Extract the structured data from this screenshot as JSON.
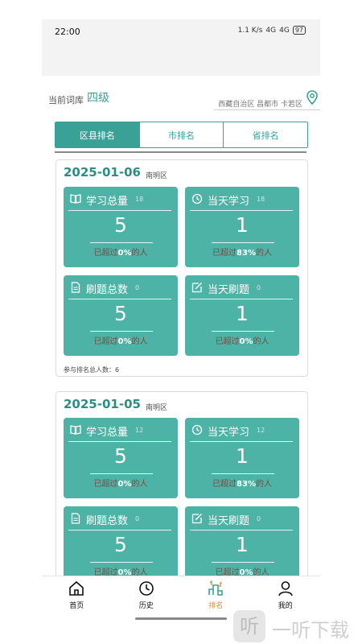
{
  "status": {
    "time": "22:00",
    "net": "1.1 K/s",
    "signal1": "4G",
    "signal2": "4G",
    "battery": "97"
  },
  "library": {
    "label": "当前词库",
    "value": "四级",
    "location": "西藏自治区 昌都市 卡若区"
  },
  "tabs": [
    "区县排名",
    "市排名",
    "省排名"
  ],
  "cards": [
    {
      "date": "2025-01-06",
      "district": "南明区",
      "tiles": [
        {
          "title": "学习总量",
          "small": "18",
          "value": "5",
          "foot_pre": "已超过",
          "pct": "0%",
          "foot_post": "的人",
          "icon": "book-icon"
        },
        {
          "title": "当天学习",
          "small": "18",
          "value": "1",
          "foot_pre": "已超过",
          "pct": "83%",
          "foot_post": "的人",
          "icon": "clock-icon"
        },
        {
          "title": "刷题总数",
          "small": "0",
          "value": "5",
          "foot_pre": "已超过",
          "pct": "0%",
          "foot_post": "的人",
          "icon": "document-icon"
        },
        {
          "title": "当天刷题",
          "small": "0",
          "value": "1",
          "foot_pre": "已超过",
          "pct": "0%",
          "foot_post": "的人",
          "icon": "edit-icon"
        }
      ],
      "total": "参与排名总人数：6"
    },
    {
      "date": "2025-01-05",
      "district": "南明区",
      "tiles": [
        {
          "title": "学习总量",
          "small": "12",
          "value": "5",
          "foot_pre": "已超过",
          "pct": "0%",
          "foot_post": "的人",
          "icon": "book-icon"
        },
        {
          "title": "当天学习",
          "small": "12",
          "value": "1",
          "foot_pre": "已超过",
          "pct": "83%",
          "foot_post": "的人",
          "icon": "clock-icon"
        },
        {
          "title": "刷题总数",
          "small": "0",
          "value": "5",
          "foot_pre": "已超过",
          "pct": "0%",
          "foot_post": "的人",
          "icon": "document-icon"
        },
        {
          "title": "当天刷题",
          "small": "0",
          "value": "1",
          "foot_pre": "已超过",
          "pct": "0%",
          "foot_post": "的人",
          "icon": "edit-icon"
        }
      ]
    }
  ],
  "nav": [
    {
      "label": "首页",
      "icon": "home-icon"
    },
    {
      "label": "历史",
      "icon": "clock-icon"
    },
    {
      "label": "排名",
      "icon": "ranking-icon",
      "active": true
    },
    {
      "label": "我的",
      "icon": "person-icon"
    }
  ],
  "watermark": {
    "logo": "听",
    "text": "一听下载"
  },
  "colors": {
    "accent": "#3aa196",
    "tile": "#4db3a6",
    "nav_active": "#e08a3a"
  }
}
